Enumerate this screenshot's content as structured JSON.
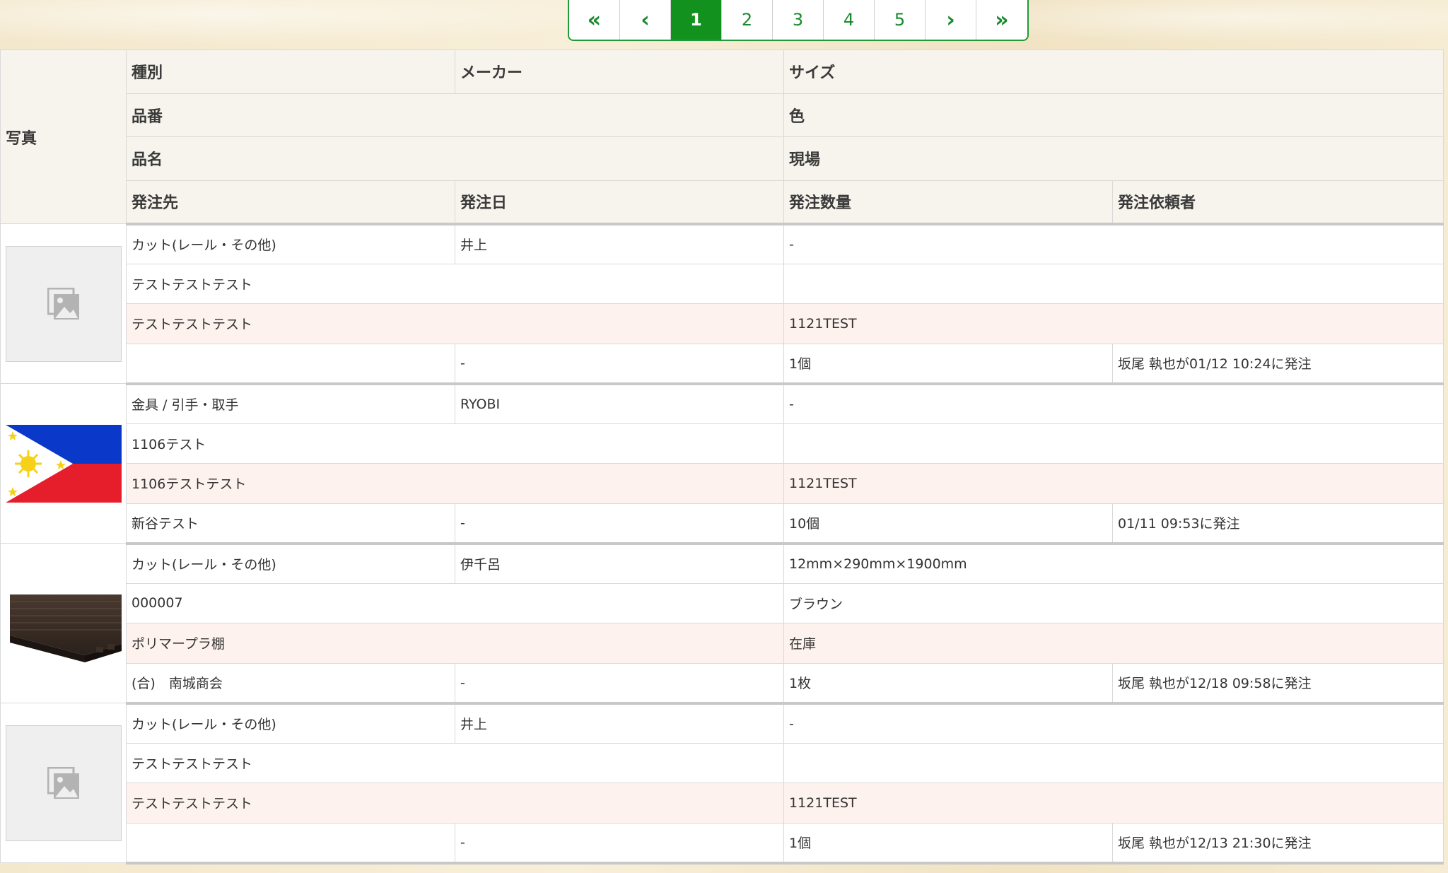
{
  "pagination": {
    "first": "«",
    "prev": "‹",
    "pages": [
      "1",
      "2",
      "3",
      "4",
      "5"
    ],
    "next": "›",
    "last": "»"
  },
  "header": {
    "photo": "写真",
    "type": "種別",
    "maker": "メーカー",
    "size": "サイズ",
    "part_no": "品番",
    "color": "色",
    "product_name": "品名",
    "site": "現場",
    "supplier": "発注先",
    "order_date": "発注日",
    "quantity": "発注数量",
    "requester": "発注依頼者"
  },
  "items": [
    {
      "photo": "placeholder-image-icon",
      "type": "カット(レール・その他)",
      "maker": "井上",
      "size": "-",
      "part_no": "テストテストテスト",
      "color": "",
      "product_name": "テストテストテスト",
      "site": "1121TEST",
      "supplier": "",
      "order_date": "-",
      "quantity": "1個",
      "requester": "坂尾 執也が01/12 10:24に発注"
    },
    {
      "photo": "philippines-flag-image",
      "type": "金具 / 引手・取手",
      "maker": "RYOBI",
      "size": "-",
      "part_no": "1106テスト",
      "color": "",
      "product_name": "1106テストテスト",
      "site": "1121TEST",
      "supplier": "新谷テスト",
      "order_date": "-",
      "quantity": "10個",
      "requester": "01/11 09:53に発注"
    },
    {
      "photo": "shelf-board-image",
      "type": "カット(レール・その他)",
      "maker": "伊千呂",
      "size": "12mm×290mm×1900mm",
      "part_no": "000007",
      "color": "ブラウン",
      "product_name": "ポリマープラ棚",
      "site": "在庫",
      "supplier": "(合)　南城商会",
      "order_date": "-",
      "quantity": "1枚",
      "requester": "坂尾 執也が12/18 09:58に発注"
    },
    {
      "photo": "placeholder-image-icon",
      "type": "カット(レール・その他)",
      "maker": "井上",
      "size": "-",
      "part_no": "テストテストテスト",
      "color": "",
      "product_name": "テストテストテスト",
      "site": "1121TEST",
      "supplier": "",
      "order_date": "-",
      "quantity": "1個",
      "requester": "坂尾 執也が12/13 21:30に発注"
    }
  ],
  "colors": {
    "accent": "#13911f",
    "link": "#1a5fb4",
    "row_highlight": "#fdf2ee"
  }
}
